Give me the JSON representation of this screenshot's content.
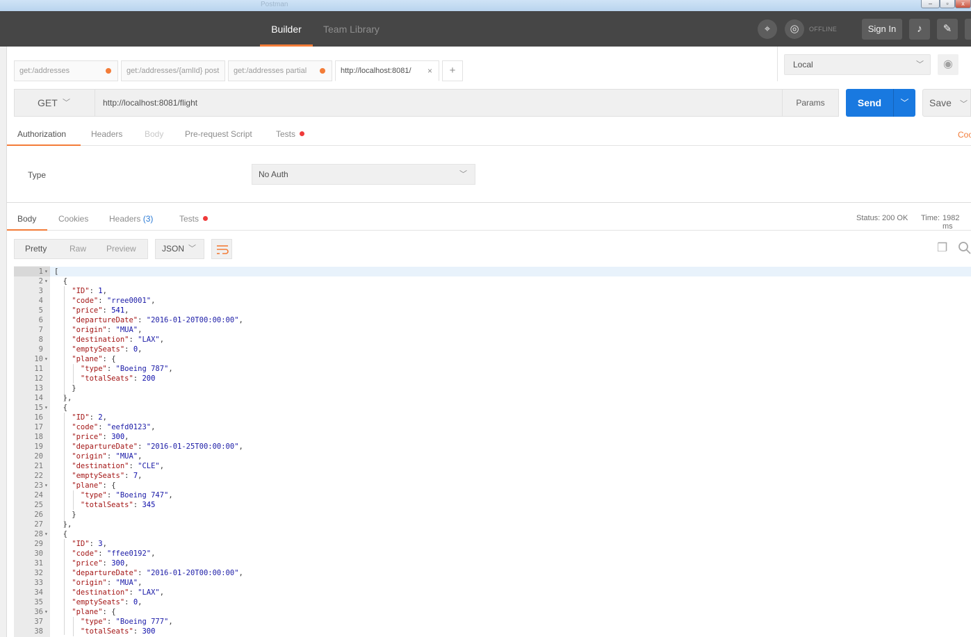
{
  "window": {
    "title": "Postman"
  },
  "appbar": {
    "nav": [
      "Builder",
      "Team Library"
    ],
    "offline_label": "OFFLINE",
    "sign_in": "Sign In"
  },
  "tabs": [
    {
      "label": "get:/addresses",
      "dirty": true
    },
    {
      "label": "get:/addresses/{amlId} post",
      "dirty": false
    },
    {
      "label": "get:/addresses partial",
      "dirty": true
    },
    {
      "label": "http://localhost:8081/",
      "active": true,
      "close": "×"
    }
  ],
  "add_tab": "+",
  "environment": {
    "selected": "Local"
  },
  "request": {
    "method": "GET",
    "url": "http://localhost:8081/flight",
    "params_label": "Params",
    "send_label": "Send",
    "save_label": "Save"
  },
  "request_tabs": [
    "Authorization",
    "Headers",
    "Body",
    "Pre-request Script",
    "Tests"
  ],
  "code_link": "Coo",
  "auth": {
    "type_label": "Type",
    "type_value": "No Auth"
  },
  "response_tabs": {
    "body": "Body",
    "cookies": "Cookies",
    "headers": "Headers",
    "headers_count": "(3)",
    "tests": "Tests"
  },
  "response_status": {
    "status_label": "Status:",
    "status_value": "200 OK",
    "time_label": "Time:",
    "time_value": "1982 ms"
  },
  "response_toolbar": {
    "formats": [
      "Pretty",
      "Raw",
      "Preview"
    ],
    "language": "JSON"
  },
  "icons": {
    "appbar": [
      "satellite-icon",
      "sync-icon",
      "bell-icon",
      "wrench-icon"
    ],
    "response": [
      "wrap-lines-icon",
      "copy-icon",
      "search-icon"
    ]
  },
  "colors": {
    "accent": "#f37c38",
    "send": "#1979e0",
    "appbar": "#464646",
    "link": "#2a7ad5",
    "dot": "#ef3a3a"
  },
  "response_lines": [
    [
      {
        "t": "p",
        "v": "["
      }
    ],
    [
      {
        "t": "p",
        "v": "  {"
      }
    ],
    [
      {
        "t": "k",
        "v": "    \"ID\""
      },
      {
        "t": "p",
        "v": ": "
      },
      {
        "t": "n",
        "v": "1"
      },
      {
        "t": "p",
        "v": ","
      }
    ],
    [
      {
        "t": "k",
        "v": "    \"code\""
      },
      {
        "t": "p",
        "v": ": "
      },
      {
        "t": "s",
        "v": "\"rree0001\""
      },
      {
        "t": "p",
        "v": ","
      }
    ],
    [
      {
        "t": "k",
        "v": "    \"price\""
      },
      {
        "t": "p",
        "v": ": "
      },
      {
        "t": "n",
        "v": "541"
      },
      {
        "t": "p",
        "v": ","
      }
    ],
    [
      {
        "t": "k",
        "v": "    \"departureDate\""
      },
      {
        "t": "p",
        "v": ": "
      },
      {
        "t": "s",
        "v": "\"2016-01-20T00:00:00\""
      },
      {
        "t": "p",
        "v": ","
      }
    ],
    [
      {
        "t": "k",
        "v": "    \"origin\""
      },
      {
        "t": "p",
        "v": ": "
      },
      {
        "t": "s",
        "v": "\"MUA\""
      },
      {
        "t": "p",
        "v": ","
      }
    ],
    [
      {
        "t": "k",
        "v": "    \"destination\""
      },
      {
        "t": "p",
        "v": ": "
      },
      {
        "t": "s",
        "v": "\"LAX\""
      },
      {
        "t": "p",
        "v": ","
      }
    ],
    [
      {
        "t": "k",
        "v": "    \"emptySeats\""
      },
      {
        "t": "p",
        "v": ": "
      },
      {
        "t": "n",
        "v": "0"
      },
      {
        "t": "p",
        "v": ","
      }
    ],
    [
      {
        "t": "k",
        "v": "    \"plane\""
      },
      {
        "t": "p",
        "v": ": {"
      }
    ],
    [
      {
        "t": "k",
        "v": "      \"type\""
      },
      {
        "t": "p",
        "v": ": "
      },
      {
        "t": "s",
        "v": "\"Boeing 787\""
      },
      {
        "t": "p",
        "v": ","
      }
    ],
    [
      {
        "t": "k",
        "v": "      \"totalSeats\""
      },
      {
        "t": "p",
        "v": ": "
      },
      {
        "t": "n",
        "v": "200"
      }
    ],
    [
      {
        "t": "p",
        "v": "    }"
      }
    ],
    [
      {
        "t": "p",
        "v": "  },"
      }
    ],
    [
      {
        "t": "p",
        "v": "  {"
      }
    ],
    [
      {
        "t": "k",
        "v": "    \"ID\""
      },
      {
        "t": "p",
        "v": ": "
      },
      {
        "t": "n",
        "v": "2"
      },
      {
        "t": "p",
        "v": ","
      }
    ],
    [
      {
        "t": "k",
        "v": "    \"code\""
      },
      {
        "t": "p",
        "v": ": "
      },
      {
        "t": "s",
        "v": "\"eefd0123\""
      },
      {
        "t": "p",
        "v": ","
      }
    ],
    [
      {
        "t": "k",
        "v": "    \"price\""
      },
      {
        "t": "p",
        "v": ": "
      },
      {
        "t": "n",
        "v": "300"
      },
      {
        "t": "p",
        "v": ","
      }
    ],
    [
      {
        "t": "k",
        "v": "    \"departureDate\""
      },
      {
        "t": "p",
        "v": ": "
      },
      {
        "t": "s",
        "v": "\"2016-01-25T00:00:00\""
      },
      {
        "t": "p",
        "v": ","
      }
    ],
    [
      {
        "t": "k",
        "v": "    \"origin\""
      },
      {
        "t": "p",
        "v": ": "
      },
      {
        "t": "s",
        "v": "\"MUA\""
      },
      {
        "t": "p",
        "v": ","
      }
    ],
    [
      {
        "t": "k",
        "v": "    \"destination\""
      },
      {
        "t": "p",
        "v": ": "
      },
      {
        "t": "s",
        "v": "\"CLE\""
      },
      {
        "t": "p",
        "v": ","
      }
    ],
    [
      {
        "t": "k",
        "v": "    \"emptySeats\""
      },
      {
        "t": "p",
        "v": ": "
      },
      {
        "t": "n",
        "v": "7"
      },
      {
        "t": "p",
        "v": ","
      }
    ],
    [
      {
        "t": "k",
        "v": "    \"plane\""
      },
      {
        "t": "p",
        "v": ": {"
      }
    ],
    [
      {
        "t": "k",
        "v": "      \"type\""
      },
      {
        "t": "p",
        "v": ": "
      },
      {
        "t": "s",
        "v": "\"Boeing 747\""
      },
      {
        "t": "p",
        "v": ","
      }
    ],
    [
      {
        "t": "k",
        "v": "      \"totalSeats\""
      },
      {
        "t": "p",
        "v": ": "
      },
      {
        "t": "n",
        "v": "345"
      }
    ],
    [
      {
        "t": "p",
        "v": "    }"
      }
    ],
    [
      {
        "t": "p",
        "v": "  },"
      }
    ],
    [
      {
        "t": "p",
        "v": "  {"
      }
    ],
    [
      {
        "t": "k",
        "v": "    \"ID\""
      },
      {
        "t": "p",
        "v": ": "
      },
      {
        "t": "n",
        "v": "3"
      },
      {
        "t": "p",
        "v": ","
      }
    ],
    [
      {
        "t": "k",
        "v": "    \"code\""
      },
      {
        "t": "p",
        "v": ": "
      },
      {
        "t": "s",
        "v": "\"ffee0192\""
      },
      {
        "t": "p",
        "v": ","
      }
    ],
    [
      {
        "t": "k",
        "v": "    \"price\""
      },
      {
        "t": "p",
        "v": ": "
      },
      {
        "t": "n",
        "v": "300"
      },
      {
        "t": "p",
        "v": ","
      }
    ],
    [
      {
        "t": "k",
        "v": "    \"departureDate\""
      },
      {
        "t": "p",
        "v": ": "
      },
      {
        "t": "s",
        "v": "\"2016-01-20T00:00:00\""
      },
      {
        "t": "p",
        "v": ","
      }
    ],
    [
      {
        "t": "k",
        "v": "    \"origin\""
      },
      {
        "t": "p",
        "v": ": "
      },
      {
        "t": "s",
        "v": "\"MUA\""
      },
      {
        "t": "p",
        "v": ","
      }
    ],
    [
      {
        "t": "k",
        "v": "    \"destination\""
      },
      {
        "t": "p",
        "v": ": "
      },
      {
        "t": "s",
        "v": "\"LAX\""
      },
      {
        "t": "p",
        "v": ","
      }
    ],
    [
      {
        "t": "k",
        "v": "    \"emptySeats\""
      },
      {
        "t": "p",
        "v": ": "
      },
      {
        "t": "n",
        "v": "0"
      },
      {
        "t": "p",
        "v": ","
      }
    ],
    [
      {
        "t": "k",
        "v": "    \"plane\""
      },
      {
        "t": "p",
        "v": ": {"
      }
    ],
    [
      {
        "t": "k",
        "v": "      \"type\""
      },
      {
        "t": "p",
        "v": ": "
      },
      {
        "t": "s",
        "v": "\"Boeing 777\""
      },
      {
        "t": "p",
        "v": ","
      }
    ],
    [
      {
        "t": "k",
        "v": "      \"totalSeats\""
      },
      {
        "t": "p",
        "v": ": "
      },
      {
        "t": "n",
        "v": "300"
      }
    ]
  ],
  "fold_lines": [
    1,
    2,
    10,
    15,
    23,
    28,
    36
  ]
}
